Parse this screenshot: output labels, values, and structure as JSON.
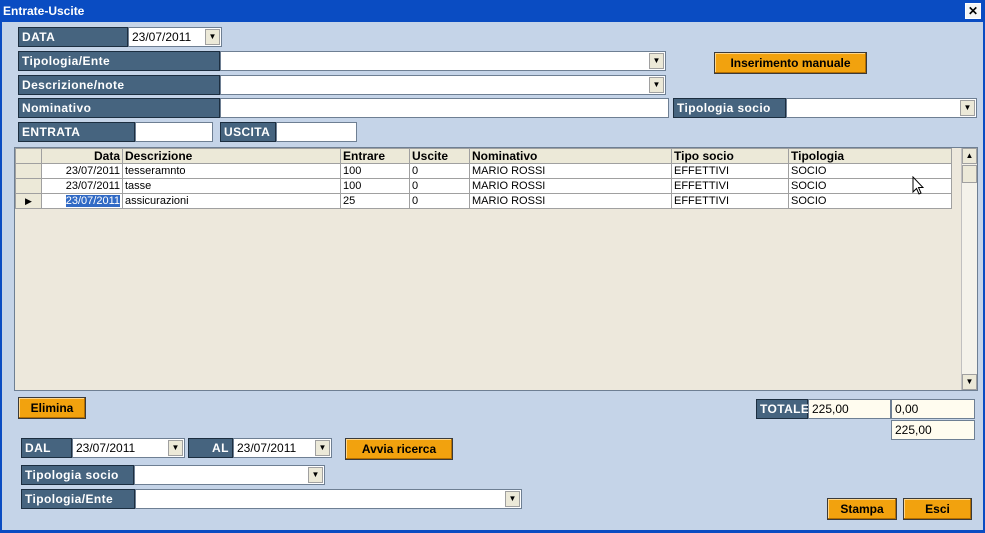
{
  "window": {
    "title": "Entrate-Uscite",
    "close_glyph": "✕"
  },
  "form": {
    "data_label": "DATA",
    "data_value": "23/07/2011",
    "tipologia_ente_label": "Tipologia/Ente",
    "tipologia_ente_value": "",
    "descrizione_label": "Descrizione/note",
    "descrizione_value": "",
    "nominativo_label": "Nominativo",
    "nominativo_value": "",
    "tipologia_socio_label": "Tipologia socio",
    "tipologia_socio_value": "",
    "entrata_label": "ENTRATA",
    "entrata_value": "",
    "uscita_label": "USCITA",
    "uscita_value": "",
    "inserimento_button": "Inserimento manuale"
  },
  "grid": {
    "columns": [
      "Data",
      "Descrizione",
      "Entrare",
      "Uscite",
      "Nominativo",
      "Tipo socio",
      "Tipologia"
    ],
    "rows": [
      {
        "data": "23/07/2011",
        "descrizione": "tesseramnto",
        "entrare": "100",
        "uscite": "0",
        "nominativo": "MARIO ROSSI",
        "tipo_socio": "EFFETTIVI",
        "tipologia": "SOCIO"
      },
      {
        "data": "23/07/2011",
        "descrizione": "tasse",
        "entrare": "100",
        "uscite": "0",
        "nominativo": "MARIO ROSSI",
        "tipo_socio": "EFFETTIVI",
        "tipologia": "SOCIO"
      },
      {
        "data": "23/07/2011",
        "descrizione": "assicurazioni",
        "entrare": "25",
        "uscite": "0",
        "nominativo": "MARIO ROSSI",
        "tipo_socio": "EFFETTIVI",
        "tipologia": "SOCIO"
      }
    ],
    "current_row_marker": "▶"
  },
  "actions": {
    "elimina_button": "Elimina",
    "stampa_button": "Stampa",
    "esci_button": "Esci",
    "avvia_button": "Avvia ricerca"
  },
  "totals": {
    "label": "TOTALE",
    "entrate": "225,00",
    "uscite": "0,00",
    "saldo": "225,00"
  },
  "search": {
    "dal_label": "DAL",
    "dal_value": "23/07/2011",
    "al_label": "AL",
    "al_value": "23/07/2011",
    "tipologia_socio_label": "Tipologia socio",
    "tipologia_socio_value": "",
    "tipologia_ente_label": "Tipologia/Ente",
    "tipologia_ente_value": ""
  },
  "icons": {
    "dropdown": "chevron-down-icon",
    "scroll_up": "arrow-up-icon",
    "scroll_down": "arrow-down-icon",
    "cursor": "mouse-pointer-icon"
  },
  "colors": {
    "titlebar": "#0a4cc2",
    "background": "#c5d4e8",
    "label_bg": "#46647f",
    "button": "#f2a20e",
    "selection": "#316ac5"
  }
}
